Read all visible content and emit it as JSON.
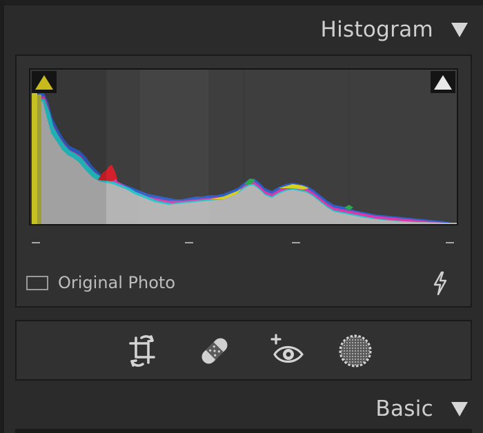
{
  "histogram_panel": {
    "title": "Histogram",
    "original_photo_label": "Original Photo",
    "original_photo_checked": false,
    "shadow_clip_icon": "triangle-up-icon",
    "highlight_clip_icon": "triangle-up-icon",
    "auto_icon": "lightning-bolt-icon",
    "colors": {
      "shadow_clip": "#c8b91c",
      "highlight_clip": "#e8e8e8",
      "luminance": "#b4b4b4"
    }
  },
  "tool_strip": {
    "tools": [
      {
        "name": "crop",
        "icon": "crop-icon"
      },
      {
        "name": "healing",
        "icon": "bandage-icon"
      },
      {
        "name": "red-eye",
        "icon": "eye-plus-icon"
      },
      {
        "name": "masking",
        "icon": "mask-circle-icon"
      }
    ]
  },
  "basic_panel": {
    "title": "Basic"
  }
}
